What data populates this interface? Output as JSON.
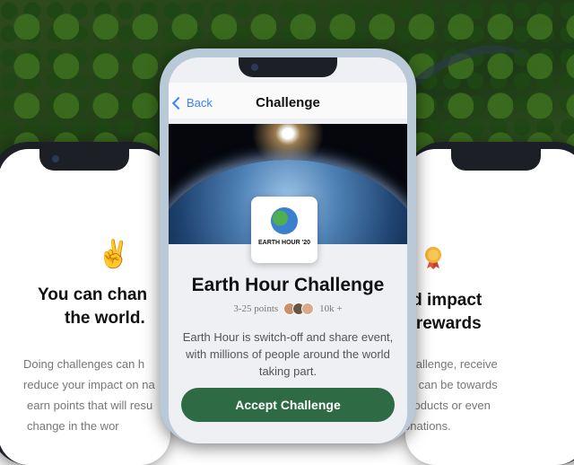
{
  "left_card": {
    "emoji": "✌️",
    "headline_1": "You can chan",
    "headline_2": "the world.",
    "body": [
      "Doing challenges can h",
      "reduce your impact on na",
      "earn points that will resu",
      "change in the wor"
    ]
  },
  "right_card": {
    "headline_1": "ced impact",
    "headline_2": "s rewards",
    "body": [
      "challenge, receive",
      "its can be towards",
      "products or even",
      "onations."
    ]
  },
  "center": {
    "back_label": "Back",
    "title": "Challenge",
    "badge_text": "EARTH HOUR '20",
    "challenge_title": "Earth Hour Challenge",
    "points": "3-25 points",
    "participants": "10k +",
    "description": "Earth Hour is switch-off and share event, with millions of people around the world taking part.",
    "accept_label": "Accept Challenge",
    "accent_color": "#2e6a44",
    "link_color": "#3b82f6"
  }
}
